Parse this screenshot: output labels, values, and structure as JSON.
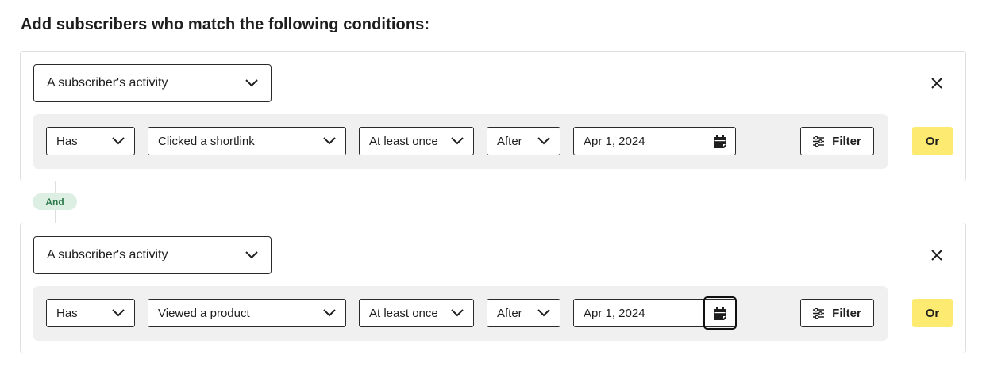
{
  "heading": "Add subscribers who match the following conditions:",
  "and_label": "And",
  "conditions": [
    {
      "type_value": "A subscriber's activity",
      "has_value": "Has",
      "event_value": "Clicked a shortlink",
      "frequency_value": "At least once",
      "time_op_value": "After",
      "date_value": "Apr 1, 2024",
      "filter_label": "Filter",
      "or_label": "Or"
    },
    {
      "type_value": "A subscriber's activity",
      "has_value": "Has",
      "event_value": "Viewed a product",
      "frequency_value": "At least once",
      "time_op_value": "After",
      "date_value": "Apr 1, 2024",
      "filter_label": "Filter",
      "or_label": "Or"
    }
  ],
  "icons": {
    "dropdown": "chevron-down-icon",
    "close": "close-icon",
    "calendar": "calendar-icon",
    "filter": "sliders-icon"
  },
  "colors": {
    "or_button": "#fdeb71",
    "and_pill_bg": "#dcefe2",
    "and_pill_text": "#2d7a4d",
    "row_bg": "#eff0ef"
  }
}
